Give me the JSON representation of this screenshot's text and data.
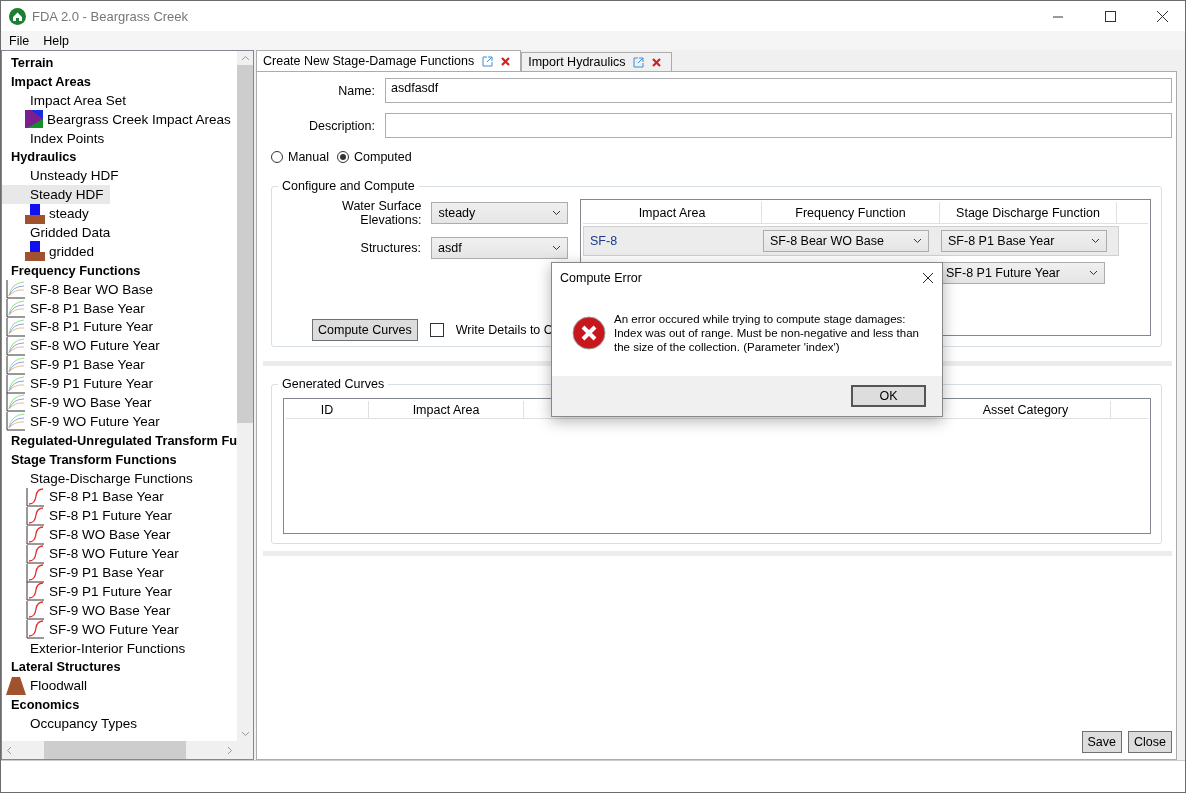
{
  "window": {
    "title": "FDA 2.0 - Beargrass Creek"
  },
  "menu": [
    "File",
    "Help"
  ],
  "tree": [
    {
      "label": "Terrain",
      "kind": "header",
      "selected": false
    },
    {
      "label": "Impact Areas",
      "kind": "header",
      "selected": false,
      "children": [
        {
          "label": "Impact Area Set",
          "kind": "text",
          "selected": false,
          "children": [
            {
              "label": "Beargrass Creek Impact Areas",
              "kind": "impact",
              "selected": false
            }
          ]
        },
        {
          "label": "Index Points",
          "kind": "text",
          "selected": false
        }
      ]
    },
    {
      "label": "Hydraulics",
      "kind": "header",
      "selected": false,
      "children": [
        {
          "label": "Unsteady HDF",
          "kind": "text",
          "selected": false
        },
        {
          "label": "Steady HDF",
          "kind": "text",
          "selected": true,
          "children": [
            {
              "label": "steady",
              "kind": "hydro",
              "selected": false
            }
          ]
        },
        {
          "label": "Gridded Data",
          "kind": "text",
          "selected": false,
          "children": [
            {
              "label": "gridded",
              "kind": "hydro",
              "selected": false
            }
          ]
        }
      ]
    },
    {
      "label": "Frequency Functions",
      "kind": "header",
      "selected": false,
      "children": [
        {
          "label": "SF-8 Bear WO Base",
          "kind": "freq",
          "selected": false
        },
        {
          "label": "SF-8 P1 Base Year",
          "kind": "freq",
          "selected": false
        },
        {
          "label": "SF-8 P1 Future Year",
          "kind": "freq",
          "selected": false
        },
        {
          "label": "SF-8 WO Future Year",
          "kind": "freq",
          "selected": false
        },
        {
          "label": "SF-9 P1 Base Year",
          "kind": "freq",
          "selected": false
        },
        {
          "label": "SF-9 P1 Future Year",
          "kind": "freq",
          "selected": false
        },
        {
          "label": "SF-9 WO Base Year",
          "kind": "freq",
          "selected": false
        },
        {
          "label": "SF-9 WO Future Year",
          "kind": "freq",
          "selected": false
        }
      ]
    },
    {
      "label": "Regulated-Unregulated Transform Fu",
      "kind": "header",
      "selected": false
    },
    {
      "label": "Stage Transform Functions",
      "kind": "header",
      "selected": false,
      "children": [
        {
          "label": "Stage-Discharge Functions",
          "kind": "text",
          "selected": false,
          "children": [
            {
              "label": "SF-8 P1 Base Year",
              "kind": "stage",
              "selected": false
            },
            {
              "label": "SF-8 P1 Future Year",
              "kind": "stage",
              "selected": false
            },
            {
              "label": "SF-8 WO Base Year",
              "kind": "stage",
              "selected": false
            },
            {
              "label": "SF-8 WO Future Year",
              "kind": "stage",
              "selected": false
            },
            {
              "label": "SF-9 P1 Base Year",
              "kind": "stage",
              "selected": false
            },
            {
              "label": "SF-9 P1 Future Year",
              "kind": "stage",
              "selected": false
            },
            {
              "label": "SF-9 WO Base Year",
              "kind": "stage",
              "selected": false
            },
            {
              "label": "SF-9 WO Future Year",
              "kind": "stage",
              "selected": false
            }
          ]
        },
        {
          "label": "Exterior-Interior Functions",
          "kind": "text",
          "selected": false
        }
      ]
    },
    {
      "label": "Lateral Structures",
      "kind": "header",
      "selected": false,
      "children": [
        {
          "label": "Floodwall",
          "kind": "floodwall",
          "selected": false
        }
      ]
    },
    {
      "label": "Economics",
      "kind": "header",
      "selected": false,
      "children": [
        {
          "label": "Occupancy Types",
          "kind": "text",
          "selected": false
        }
      ]
    }
  ],
  "tabs": [
    {
      "label": "Create New Stage-Damage Functions",
      "selected": true
    },
    {
      "label": "Import Hydraulics",
      "selected": false
    }
  ],
  "name": {
    "label": "Name:",
    "value": "asdfasdf"
  },
  "description": {
    "label": "Description:"
  },
  "mode": [
    {
      "label": "Manual",
      "selected": false
    },
    {
      "label": "Computed",
      "selected": true
    }
  ],
  "configure": {
    "title": "Configure and Compute",
    "fields": [
      {
        "label": "Water Surface Elevations:",
        "value": "steady"
      },
      {
        "label": "Structures:",
        "value": "asdf"
      }
    ],
    "compute_button": "Compute Curves",
    "write_details": {
      "label": "Write Details to C",
      "checked": false
    },
    "grid": {
      "columns": [
        "Impact Area",
        "Frequency Function",
        "Stage Discharge Function"
      ],
      "rows": [
        {
          "impact_area": "SF-8",
          "frequency_function": "SF-8 Bear WO Base",
          "stage_discharge_function": "SF-8 P1 Base Year",
          "selected": true
        },
        {
          "stage_discharge_function": "SF-8 P1 Future Year",
          "selected": false
        }
      ]
    }
  },
  "generated": {
    "title": "Generated Curves",
    "columns": [
      "ID",
      "Impact Area",
      "Asset Category"
    ]
  },
  "buttons": [
    "Save",
    "Close"
  ],
  "dialog": {
    "title": "Compute Error",
    "message": "An error occured while trying to compute stage damages:\nIndex was out of range. Must be non-negative and less than\nthe size of the collection. (Parameter 'index')",
    "button": "OK"
  }
}
